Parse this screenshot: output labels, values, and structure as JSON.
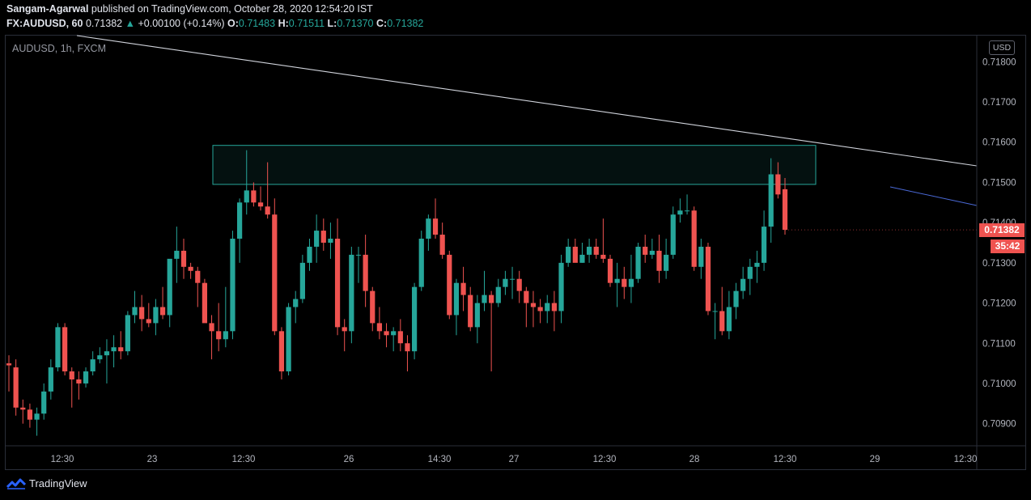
{
  "header": {
    "author": "Sangam-Agarwal",
    "published_text": "published on TradingView.com, October 28, 2020 12:54:20 IST",
    "symbol_line": "FX:AUDUSD, 60",
    "last_price": "0.71382",
    "change": "+0.00100 (+0.14%)",
    "o_label": "O:",
    "o_value": "0.71483",
    "h_label": "H:",
    "h_value": "0.71511",
    "l_label": "L:",
    "l_value": "0.71370",
    "c_label": "C:",
    "c_value": "0.71382"
  },
  "chart_title": "AUDUSD, 1h, FXCM",
  "currency_label": "USD",
  "price_tag": "0.71382",
  "countdown_tag": "35:42",
  "brand": "TradingView",
  "colors": {
    "up": "#26a69a",
    "down": "#ef5350",
    "zone": "#26a69a",
    "trendline": "#d1d4dc",
    "blue_line": "#4a69d6"
  },
  "chart_data": {
    "type": "candlestick",
    "y_axis": {
      "min": 0.7085,
      "max": 0.7185,
      "ticks": [
        "0.71800",
        "0.71700",
        "0.71600",
        "0.71500",
        "0.71400",
        "0.71300",
        "0.71200",
        "0.71100",
        "0.71000",
        "0.70900"
      ],
      "tick_values": [
        0.718,
        0.717,
        0.716,
        0.715,
        0.714,
        0.713,
        0.712,
        0.711,
        0.71,
        0.709
      ]
    },
    "x_axis": {
      "labels": [
        "12:30",
        "23",
        "12:30",
        "26",
        "14:30",
        "27",
        "12:30",
        "28",
        "12:30",
        "29",
        "12:30"
      ]
    },
    "candles": [
      [
        0.7105,
        0.7107,
        0.7098,
        0.71045
      ],
      [
        0.7104,
        0.7106,
        0.7092,
        0.7094
      ],
      [
        0.7094,
        0.7096,
        0.709,
        0.70935
      ],
      [
        0.70935,
        0.7095,
        0.7089,
        0.7091
      ],
      [
        0.7091,
        0.7094,
        0.7087,
        0.70925
      ],
      [
        0.70925,
        0.71,
        0.7091,
        0.7098
      ],
      [
        0.7098,
        0.7106,
        0.7096,
        0.7104
      ],
      [
        0.7104,
        0.7115,
        0.7103,
        0.7114
      ],
      [
        0.7114,
        0.7115,
        0.7102,
        0.7103
      ],
      [
        0.7103,
        0.7104,
        0.7094,
        0.7101
      ],
      [
        0.7101,
        0.7103,
        0.7096,
        0.71
      ],
      [
        0.71,
        0.7104,
        0.7099,
        0.7103
      ],
      [
        0.7103,
        0.7108,
        0.7102,
        0.7106
      ],
      [
        0.7106,
        0.7109,
        0.7105,
        0.7107
      ],
      [
        0.7107,
        0.7111,
        0.71,
        0.7108
      ],
      [
        0.7108,
        0.7112,
        0.7104,
        0.7109
      ],
      [
        0.7109,
        0.7113,
        0.7106,
        0.7108
      ],
      [
        0.7108,
        0.7118,
        0.7107,
        0.7117
      ],
      [
        0.7117,
        0.7123,
        0.7115,
        0.7119
      ],
      [
        0.7119,
        0.7122,
        0.7113,
        0.7116
      ],
      [
        0.7116,
        0.712,
        0.7114,
        0.7115
      ],
      [
        0.7115,
        0.7121,
        0.7112,
        0.7119
      ],
      [
        0.7119,
        0.7124,
        0.7116,
        0.7117
      ],
      [
        0.7117,
        0.7126,
        0.7114,
        0.7131
      ],
      [
        0.7131,
        0.7139,
        0.7125,
        0.7133
      ],
      [
        0.7133,
        0.7136,
        0.7126,
        0.7129
      ],
      [
        0.7129,
        0.713,
        0.7126,
        0.7128
      ],
      [
        0.7128,
        0.7129,
        0.7119,
        0.7125
      ],
      [
        0.7125,
        0.7126,
        0.7116,
        0.7115
      ],
      [
        0.7115,
        0.7117,
        0.7106,
        0.7113
      ],
      [
        0.7113,
        0.712,
        0.7108,
        0.7111
      ],
      [
        0.7111,
        0.7124,
        0.7109,
        0.7113
      ],
      [
        0.7113,
        0.7138,
        0.7111,
        0.7136
      ],
      [
        0.7136,
        0.7146,
        0.713,
        0.7145
      ],
      [
        0.7145,
        0.7158,
        0.7142,
        0.7148
      ],
      [
        0.7148,
        0.715,
        0.7144,
        0.7145
      ],
      [
        0.7145,
        0.7149,
        0.7143,
        0.7144
      ],
      [
        0.7144,
        0.7155,
        0.7141,
        0.7142
      ],
      [
        0.7142,
        0.7146,
        0.7112,
        0.7113
      ],
      [
        0.7113,
        0.7114,
        0.7101,
        0.7103
      ],
      [
        0.7103,
        0.712,
        0.7102,
        0.7119
      ],
      [
        0.7119,
        0.7123,
        0.7115,
        0.7121
      ],
      [
        0.7121,
        0.7132,
        0.712,
        0.713
      ],
      [
        0.713,
        0.7136,
        0.7128,
        0.7134
      ],
      [
        0.7134,
        0.7142,
        0.713,
        0.7138
      ],
      [
        0.7138,
        0.7141,
        0.7133,
        0.7135
      ],
      [
        0.7135,
        0.714,
        0.7131,
        0.7136
      ],
      [
        0.7136,
        0.7141,
        0.7112,
        0.7114
      ],
      [
        0.7114,
        0.7116,
        0.7108,
        0.7113
      ],
      [
        0.7113,
        0.7134,
        0.711,
        0.7132
      ],
      [
        0.7132,
        0.7134,
        0.7125,
        0.7132
      ],
      [
        0.7132,
        0.7137,
        0.7119,
        0.7123
      ],
      [
        0.7123,
        0.7124,
        0.7113,
        0.7115
      ],
      [
        0.7115,
        0.7119,
        0.7111,
        0.7113
      ],
      [
        0.7113,
        0.7115,
        0.7109,
        0.7112
      ],
      [
        0.7112,
        0.7114,
        0.7108,
        0.7113
      ],
      [
        0.7113,
        0.7116,
        0.7108,
        0.711
      ],
      [
        0.711,
        0.7112,
        0.7103,
        0.7108
      ],
      [
        0.7108,
        0.7125,
        0.7106,
        0.7124
      ],
      [
        0.7124,
        0.7138,
        0.7123,
        0.7136
      ],
      [
        0.7136,
        0.7142,
        0.7133,
        0.7141
      ],
      [
        0.7141,
        0.7146,
        0.7136,
        0.7137
      ],
      [
        0.7137,
        0.714,
        0.7131,
        0.7132
      ],
      [
        0.7132,
        0.7133,
        0.7116,
        0.7117
      ],
      [
        0.7117,
        0.7126,
        0.7112,
        0.7125
      ],
      [
        0.7125,
        0.7129,
        0.7118,
        0.7122
      ],
      [
        0.7122,
        0.7124,
        0.7113,
        0.7114
      ],
      [
        0.7114,
        0.7122,
        0.711,
        0.712
      ],
      [
        0.712,
        0.7128,
        0.7118,
        0.7122
      ],
      [
        0.7122,
        0.7123,
        0.7103,
        0.712
      ],
      [
        0.712,
        0.7126,
        0.7119,
        0.7124
      ],
      [
        0.7124,
        0.7128,
        0.7122,
        0.7126
      ],
      [
        0.7126,
        0.7129,
        0.7121,
        0.7126
      ],
      [
        0.7126,
        0.7128,
        0.712,
        0.7123
      ],
      [
        0.7123,
        0.7124,
        0.7114,
        0.712
      ],
      [
        0.712,
        0.7123,
        0.7114,
        0.7119
      ],
      [
        0.7119,
        0.7121,
        0.7115,
        0.7118
      ],
      [
        0.7118,
        0.7122,
        0.7115,
        0.712
      ],
      [
        0.712,
        0.7123,
        0.7113,
        0.7118
      ],
      [
        0.7118,
        0.7132,
        0.7115,
        0.713
      ],
      [
        0.713,
        0.7136,
        0.7129,
        0.7134
      ],
      [
        0.7134,
        0.7136,
        0.7132,
        0.713
      ],
      [
        0.713,
        0.7135,
        0.713,
        0.7132
      ],
      [
        0.7132,
        0.7136,
        0.713,
        0.7134
      ],
      [
        0.7134,
        0.7136,
        0.7131,
        0.7132
      ],
      [
        0.7132,
        0.7141,
        0.713,
        0.7131
      ],
      [
        0.7131,
        0.7132,
        0.7124,
        0.7125
      ],
      [
        0.7125,
        0.713,
        0.7119,
        0.7126
      ],
      [
        0.7126,
        0.7129,
        0.7121,
        0.7124
      ],
      [
        0.7124,
        0.7132,
        0.712,
        0.7126
      ],
      [
        0.7126,
        0.7135,
        0.7125,
        0.7134
      ],
      [
        0.7134,
        0.7137,
        0.713,
        0.7132
      ],
      [
        0.7132,
        0.7136,
        0.7131,
        0.7133
      ],
      [
        0.7133,
        0.7137,
        0.7125,
        0.7128
      ],
      [
        0.7128,
        0.7136,
        0.7126,
        0.7132
      ],
      [
        0.7132,
        0.7144,
        0.7131,
        0.7142
      ],
      [
        0.7142,
        0.7146,
        0.714,
        0.7143
      ],
      [
        0.7143,
        0.7147,
        0.7142,
        0.7143
      ],
      [
        0.7143,
        0.7144,
        0.7128,
        0.7129
      ],
      [
        0.7129,
        0.7136,
        0.7126,
        0.7134
      ],
      [
        0.7134,
        0.7135,
        0.7117,
        0.7118
      ],
      [
        0.7118,
        0.712,
        0.7111,
        0.7118
      ],
      [
        0.7118,
        0.7124,
        0.7112,
        0.7113
      ],
      [
        0.7113,
        0.7123,
        0.7111,
        0.7119
      ],
      [
        0.7119,
        0.7125,
        0.7116,
        0.7123
      ],
      [
        0.7123,
        0.7129,
        0.7121,
        0.7126
      ],
      [
        0.7126,
        0.7131,
        0.7122,
        0.7129
      ],
      [
        0.7129,
        0.7133,
        0.7125,
        0.713
      ],
      [
        0.713,
        0.7143,
        0.7128,
        0.7139
      ],
      [
        0.7139,
        0.7156,
        0.7135,
        0.7152
      ],
      [
        0.7152,
        0.7155,
        0.7146,
        0.7147
      ],
      [
        0.71483,
        0.71511,
        0.7137,
        0.71382
      ]
    ],
    "rectangle_zone": {
      "top": 0.71592,
      "bottom": 0.71495
    },
    "trendline": {
      "note": "descending resistance line"
    }
  }
}
